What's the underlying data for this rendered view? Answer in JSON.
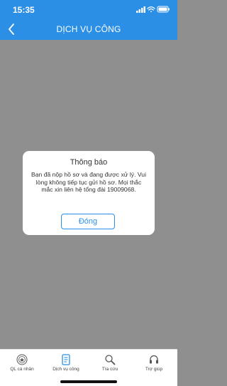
{
  "status_bar": {
    "time": "15:35"
  },
  "header": {
    "title": "DỊCH VỤ CÔNG"
  },
  "dialog": {
    "title": "Thông báo",
    "message": "Bạn đã nộp hồ sơ và đang được xử lý. Vui lòng không tiếp tục gửi hồ sơ. Mọi thắc mắc xin liên hệ tổng đài 19009068.",
    "button_label": "Đóng"
  },
  "tabbar": {
    "items": [
      {
        "label": "QL cá nhân",
        "icon": "seal-icon"
      },
      {
        "label": "Dịch vụ công",
        "icon": "document-icon",
        "active": true
      },
      {
        "label": "Tra cứu",
        "icon": "search-icon"
      },
      {
        "label": "Trợ giúp",
        "icon": "headset-icon"
      }
    ]
  },
  "colors": {
    "header_bg": "#2b8fe6",
    "overlay": "#8f8f8f",
    "accent": "#2b8fe6"
  }
}
